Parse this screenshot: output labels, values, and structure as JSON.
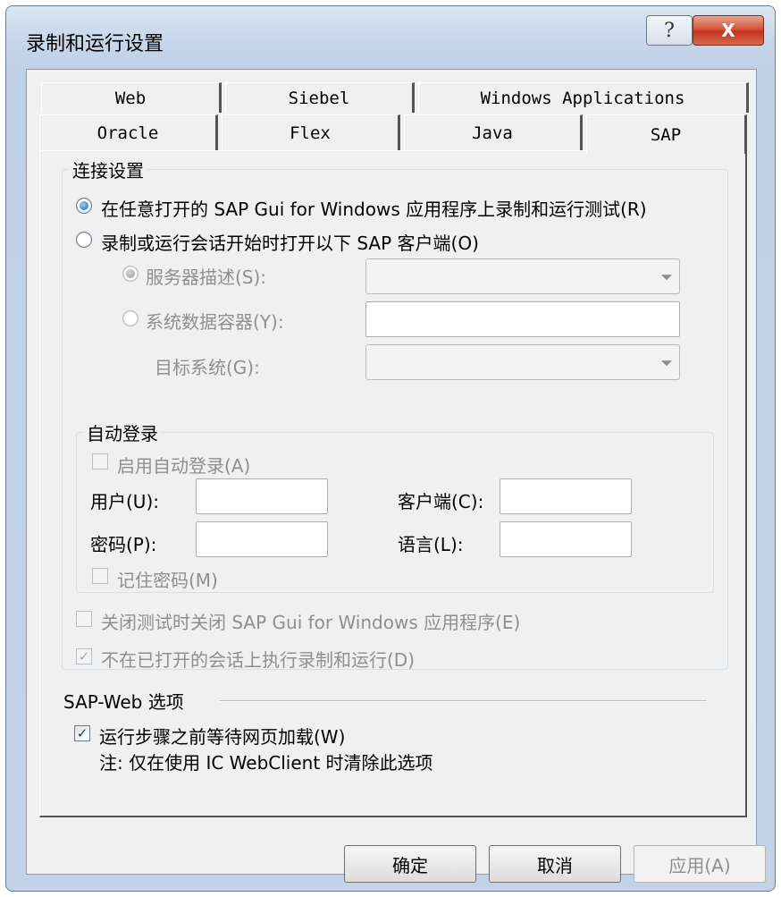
{
  "window": {
    "title": "录制和运行设置"
  },
  "tabs": {
    "row1": [
      "Web",
      "Siebel",
      "Windows Applications"
    ],
    "row2": [
      "Oracle",
      "Flex",
      "Java",
      "SAP"
    ],
    "active": "SAP"
  },
  "connection": {
    "legend": "连接设置",
    "radio_any": "在任意打开的 SAP Gui for Windows 应用程序上录制和运行测试(R)",
    "radio_open": "录制或运行会话开始时打开以下 SAP 客户端(O)",
    "server_label": "服务器描述(S):",
    "container_label": "系统数据容器(Y):",
    "target_label": "目标系统(G):",
    "autologin": {
      "legend": "自动登录",
      "enable_label": "启用自动登录(A)",
      "user_label": "用户(U):",
      "client_label": "客户端(C):",
      "password_label": "密码(P):",
      "language_label": "语言(L):",
      "remember_label": "记住密码(M)"
    },
    "close_label": "关闭测试时关闭 SAP Gui for Windows 应用程序(E)",
    "no_open_label": "不在已打开的会话上执行录制和运行(D)"
  },
  "sapweb": {
    "legend": "SAP-Web 选项",
    "wait_label": "运行步骤之前等待网页加载(W)",
    "note": "注: 仅在使用 IC WebClient 时清除此选项"
  },
  "buttons": {
    "ok": "确定",
    "cancel": "取消",
    "apply": "应用(A)"
  },
  "icons": {
    "help": "?",
    "close": "X",
    "check": "✓"
  }
}
